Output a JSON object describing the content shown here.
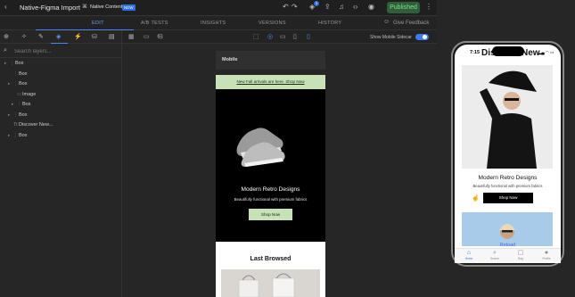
{
  "header": {
    "project_name": "Native-Figma Import",
    "content_label": "Native Content",
    "content_badge": "NEW",
    "notification_count": "1",
    "publish_label": "Published"
  },
  "tabs": [
    {
      "label": "EDIT",
      "active": true
    },
    {
      "label": "A/B TESTS",
      "active": false
    },
    {
      "label": "INSIGHTS",
      "active": false
    },
    {
      "label": "VERSIONS",
      "active": false
    },
    {
      "label": "HISTORY",
      "active": false
    }
  ],
  "feedback_label": "Give Feedback",
  "layers": {
    "search_placeholder": "Search layers...",
    "items": [
      {
        "label": "Box",
        "depth": 0,
        "expander": true,
        "glyph": "⋮"
      },
      {
        "label": "Box",
        "depth": 1,
        "expander": false,
        "glyph": "⋮"
      },
      {
        "label": "Box",
        "depth": 1,
        "expander": true,
        "glyph": "⋮"
      },
      {
        "label": "Image",
        "depth": 2,
        "expander": false,
        "glyph": "▭"
      },
      {
        "label": "Box",
        "depth": 2,
        "expander": true,
        "glyph": "⋮"
      },
      {
        "label": "Box",
        "depth": 1,
        "expander": true,
        "glyph": "⋮"
      },
      {
        "label": "Discover New...",
        "depth": 1,
        "expander": false,
        "glyph": "Tt"
      },
      {
        "label": "Box",
        "depth": 1,
        "expander": true,
        "glyph": "⋮"
      }
    ]
  },
  "canvas": {
    "sidebar_toggle_label": "Show Mobile Sidecar",
    "sidebar_toggle_on": true,
    "frame_label": "Mobile",
    "promo_text": "New Fall arrivals are here. Shop Now",
    "hero_title": "Modern Retro Designs",
    "hero_subtitle": "Beautifully functional with premium fabrics",
    "hero_button": "Shop Now",
    "section_title": "Last Browsed"
  },
  "phone": {
    "time": "7:15",
    "title": "Discover New",
    "hero_title": "Modern Retro Designs",
    "hero_subtitle": "Beautifully functional with premium fabrics",
    "button": "Shop Now",
    "reload_label": "Reload",
    "nav": [
      {
        "label": "Home",
        "icon": "⌂",
        "active": true
      },
      {
        "label": "Search",
        "icon": "⌕",
        "active": false
      },
      {
        "label": "Bag",
        "icon": "▢",
        "active": false
      },
      {
        "label": "Profile",
        "icon": "●",
        "active": false
      }
    ]
  },
  "colors": {
    "accent": "#4d86ee",
    "promo_bg": "#c7e2b6",
    "published_bg": "#2f5e3a",
    "published_text": "#7ee08a"
  }
}
